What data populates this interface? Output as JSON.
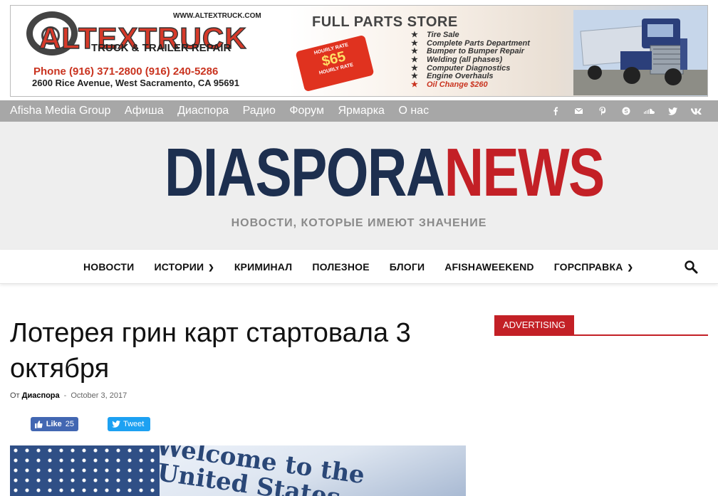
{
  "ad": {
    "website": "WWW.ALTEXTRUCK.COM",
    "brand": "ALTEXTRUCK",
    "subtitle": "TRUCK & TRAILER REPAIR",
    "phone": "Phone (916) 371-2800 (916) 240-5286",
    "address": "2600 Rice Avenue, West Sacramento, CA 95691",
    "store_title": "FULL PARTS STORE",
    "tag_top": "HOURLY RATE",
    "tag_price": "$65",
    "tag_bottom": "HOURLY RATE",
    "services": [
      "Tire Sale",
      "Complete Parts Department",
      "Bumper to Bumper Repair",
      "Welding (all phases)",
      "Computer Diagnostics",
      "Engine Overhauls",
      "Oil Change $260"
    ]
  },
  "topbar": {
    "menu": [
      "Afisha Media Group",
      "Афиша",
      "Диаспора",
      "Радио",
      "Форум",
      "Ярмарка",
      "О нас"
    ],
    "social_icons": [
      "facebook-icon",
      "mail-icon",
      "pinterest-icon",
      "skype-icon",
      "soundcloud-icon",
      "twitter-icon",
      "vk-icon"
    ]
  },
  "header": {
    "logo_part1": "DIASPORA",
    "logo_part2": "NEWS",
    "tagline": "НОВОСТИ, КОТОРЫЕ ИМЕЮТ ЗНАЧЕНИЕ",
    "colors": {
      "logo_dark": "#1d2f4f",
      "logo_red": "#c32026"
    }
  },
  "mainmenu": {
    "items": [
      {
        "label": "НОВОСТИ",
        "dropdown": false
      },
      {
        "label": "ИСТОРИИ",
        "dropdown": true
      },
      {
        "label": "КРИМИНАЛ",
        "dropdown": false
      },
      {
        "label": "ПОЛЕЗНОЕ",
        "dropdown": false
      },
      {
        "label": "БЛОГИ",
        "dropdown": false
      },
      {
        "label": "AFISHAWEEKEND",
        "dropdown": false
      },
      {
        "label": "ГОРСПРАВКА",
        "dropdown": true
      }
    ]
  },
  "article": {
    "title": "Лотерея грин карт стартовала 3 октября",
    "by_label": "От",
    "author": "Диаспора",
    "separator": "-",
    "date": "October 3, 2017",
    "like_label": "Like",
    "like_count": "25",
    "tweet_label": "Tweet",
    "image_text_line1": "Welcome to the",
    "image_text_line2": "United States"
  },
  "sidebar": {
    "heading": "ADVERTISING"
  }
}
